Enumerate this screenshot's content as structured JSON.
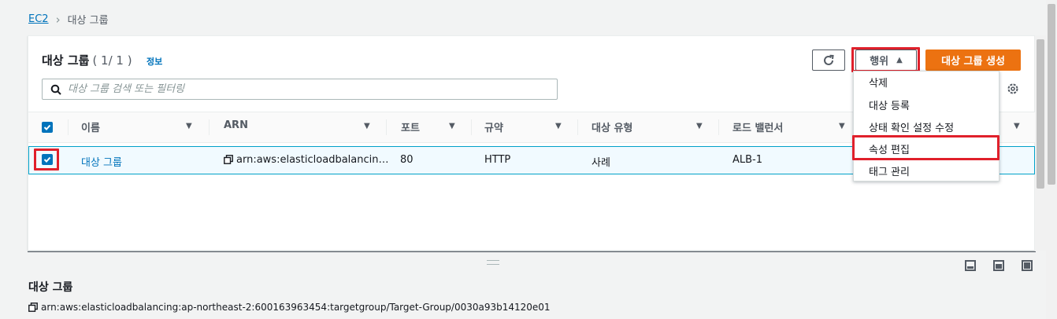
{
  "breadcrumb": {
    "root": "EC2",
    "current": "대상 그룹"
  },
  "panel": {
    "title": "대상 그룹",
    "count": "( 1/ 1 )",
    "info": "정보"
  },
  "toolbar": {
    "actions_label": "행위",
    "create_label": "대상 그룹 생성"
  },
  "search": {
    "placeholder": "대상 그룹 검색 또는 필터링"
  },
  "table": {
    "columns": [
      "이름",
      "ARN",
      "포트",
      "규약",
      "대상 유형",
      "로드 밸런서"
    ],
    "rows": [
      {
        "name": "대상 그룹",
        "arn": "arn:aws:elasticloadbalancin…",
        "port": "80",
        "protocol": "HTTP",
        "target_type": "사례",
        "load_balancer": "ALB-1"
      }
    ]
  },
  "actions_menu": [
    "삭제",
    "대상 등록",
    "상태 확인 설정 수정",
    "속성 편집",
    "태그 관리"
  ],
  "detail": {
    "title": "대상 그룹",
    "arn": "arn:aws:elasticloadbalancing:ap-northeast-2:600163963454:targetgroup/Target-Group/0030a93b14120e01"
  },
  "colors": {
    "accent": "#0073bb",
    "primary": "#ec7211",
    "highlight": "#e0202b"
  }
}
